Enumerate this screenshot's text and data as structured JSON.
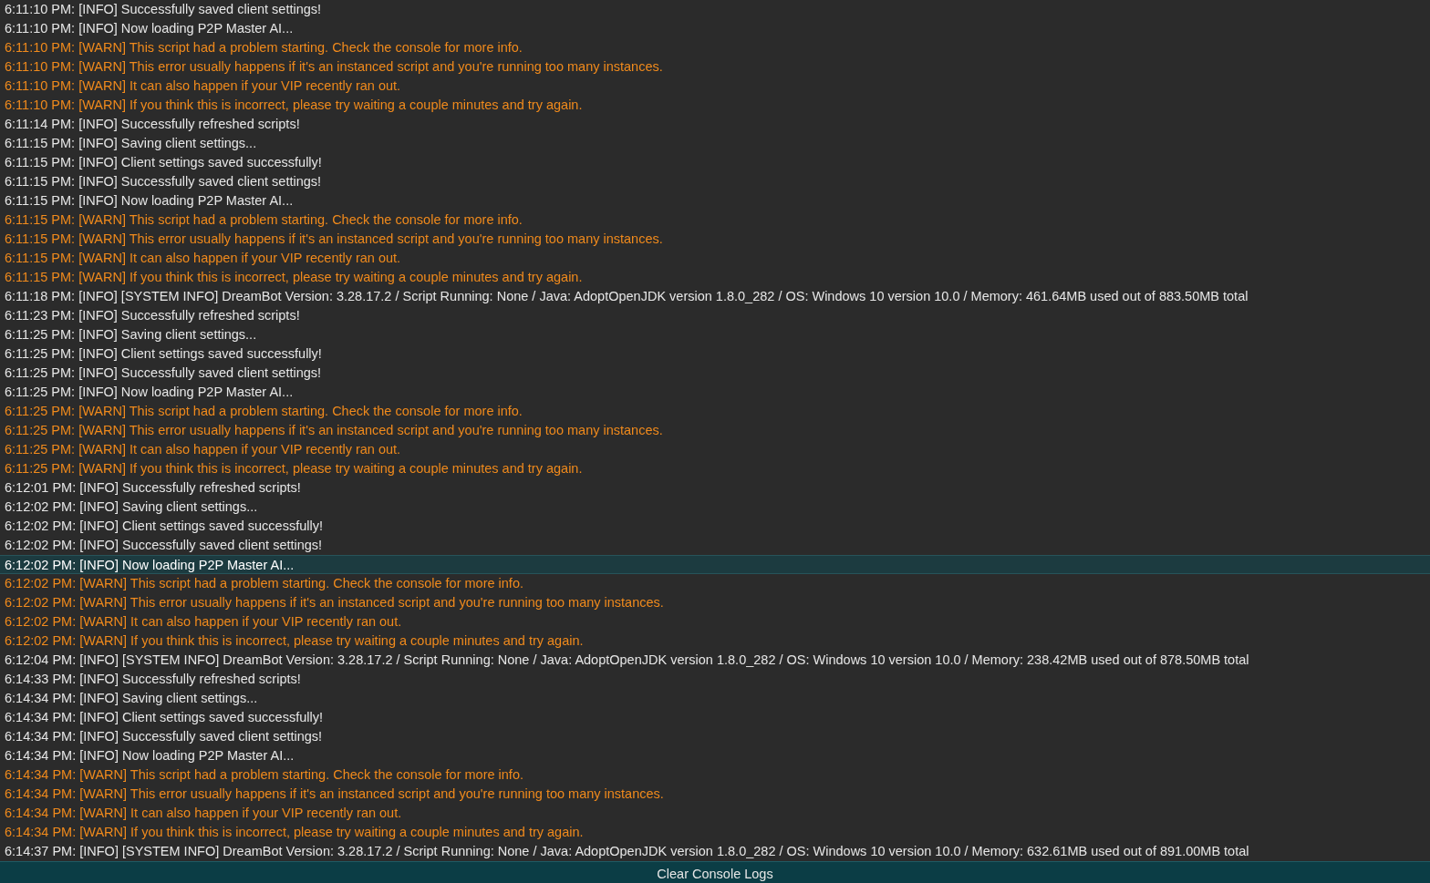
{
  "log_lines": [
    {
      "kind": "info",
      "selected": false,
      "text": "6:11:10 PM: [INFO] Successfully saved client settings!"
    },
    {
      "kind": "info",
      "selected": false,
      "text": "6:11:10 PM: [INFO] Now loading P2P Master AI..."
    },
    {
      "kind": "warn",
      "selected": false,
      "text": "6:11:10 PM: [WARN] This script had a problem starting. Check the console for more info."
    },
    {
      "kind": "warn",
      "selected": false,
      "text": "6:11:10 PM: [WARN] This error usually happens if it's an instanced script and you're running too many instances."
    },
    {
      "kind": "warn",
      "selected": false,
      "text": "6:11:10 PM: [WARN] It can also happen if your VIP recently ran out."
    },
    {
      "kind": "warn",
      "selected": false,
      "text": "6:11:10 PM: [WARN] If you think this is incorrect, please try waiting a couple minutes and try again."
    },
    {
      "kind": "info",
      "selected": false,
      "text": "6:11:14 PM: [INFO] Successfully refreshed scripts!"
    },
    {
      "kind": "info",
      "selected": false,
      "text": "6:11:15 PM: [INFO] Saving client settings..."
    },
    {
      "kind": "info",
      "selected": false,
      "text": "6:11:15 PM: [INFO] Client settings saved successfully!"
    },
    {
      "kind": "info",
      "selected": false,
      "text": "6:11:15 PM: [INFO] Successfully saved client settings!"
    },
    {
      "kind": "info",
      "selected": false,
      "text": "6:11:15 PM: [INFO] Now loading P2P Master AI..."
    },
    {
      "kind": "warn",
      "selected": false,
      "text": "6:11:15 PM: [WARN] This script had a problem starting. Check the console for more info."
    },
    {
      "kind": "warn",
      "selected": false,
      "text": "6:11:15 PM: [WARN] This error usually happens if it's an instanced script and you're running too many instances."
    },
    {
      "kind": "warn",
      "selected": false,
      "text": "6:11:15 PM: [WARN] It can also happen if your VIP recently ran out."
    },
    {
      "kind": "warn",
      "selected": false,
      "text": "6:11:15 PM: [WARN] If you think this is incorrect, please try waiting a couple minutes and try again."
    },
    {
      "kind": "info",
      "selected": false,
      "text": "6:11:18 PM: [INFO] [SYSTEM INFO] DreamBot Version: 3.28.17.2 / Script Running: None / Java: AdoptOpenJDK version 1.8.0_282 / OS: Windows 10 version 10.0 / Memory: 461.64MB used out of 883.50MB total"
    },
    {
      "kind": "info",
      "selected": false,
      "text": "6:11:23 PM: [INFO] Successfully refreshed scripts!"
    },
    {
      "kind": "info",
      "selected": false,
      "text": "6:11:25 PM: [INFO] Saving client settings..."
    },
    {
      "kind": "info",
      "selected": false,
      "text": "6:11:25 PM: [INFO] Client settings saved successfully!"
    },
    {
      "kind": "info",
      "selected": false,
      "text": "6:11:25 PM: [INFO] Successfully saved client settings!"
    },
    {
      "kind": "info",
      "selected": false,
      "text": "6:11:25 PM: [INFO] Now loading P2P Master AI..."
    },
    {
      "kind": "warn",
      "selected": false,
      "text": "6:11:25 PM: [WARN] This script had a problem starting. Check the console for more info."
    },
    {
      "kind": "warn",
      "selected": false,
      "text": "6:11:25 PM: [WARN] This error usually happens if it's an instanced script and you're running too many instances."
    },
    {
      "kind": "warn",
      "selected": false,
      "text": "6:11:25 PM: [WARN] It can also happen if your VIP recently ran out."
    },
    {
      "kind": "warn",
      "selected": false,
      "text": "6:11:25 PM: [WARN] If you think this is incorrect, please try waiting a couple minutes and try again."
    },
    {
      "kind": "info",
      "selected": false,
      "text": "6:12:01 PM: [INFO] Successfully refreshed scripts!"
    },
    {
      "kind": "info",
      "selected": false,
      "text": "6:12:02 PM: [INFO] Saving client settings..."
    },
    {
      "kind": "info",
      "selected": false,
      "text": "6:12:02 PM: [INFO] Client settings saved successfully!"
    },
    {
      "kind": "info",
      "selected": false,
      "text": "6:12:02 PM: [INFO] Successfully saved client settings!"
    },
    {
      "kind": "info",
      "selected": true,
      "text": "6:12:02 PM: [INFO] Now loading P2P Master AI..."
    },
    {
      "kind": "warn",
      "selected": false,
      "text": "6:12:02 PM: [WARN] This script had a problem starting. Check the console for more info."
    },
    {
      "kind": "warn",
      "selected": false,
      "text": "6:12:02 PM: [WARN] This error usually happens if it's an instanced script and you're running too many instances."
    },
    {
      "kind": "warn",
      "selected": false,
      "text": "6:12:02 PM: [WARN] It can also happen if your VIP recently ran out."
    },
    {
      "kind": "warn",
      "selected": false,
      "text": "6:12:02 PM: [WARN] If you think this is incorrect, please try waiting a couple minutes and try again."
    },
    {
      "kind": "info",
      "selected": false,
      "text": "6:12:04 PM: [INFO] [SYSTEM INFO] DreamBot Version: 3.28.17.2 / Script Running: None / Java: AdoptOpenJDK version 1.8.0_282 / OS: Windows 10 version 10.0 / Memory: 238.42MB used out of 878.50MB total"
    },
    {
      "kind": "info",
      "selected": false,
      "text": "6:14:33 PM: [INFO] Successfully refreshed scripts!"
    },
    {
      "kind": "info",
      "selected": false,
      "text": "6:14:34 PM: [INFO] Saving client settings..."
    },
    {
      "kind": "info",
      "selected": false,
      "text": "6:14:34 PM: [INFO] Client settings saved successfully!"
    },
    {
      "kind": "info",
      "selected": false,
      "text": "6:14:34 PM: [INFO] Successfully saved client settings!"
    },
    {
      "kind": "info",
      "selected": false,
      "text": "6:14:34 PM: [INFO] Now loading P2P Master AI..."
    },
    {
      "kind": "warn",
      "selected": false,
      "text": "6:14:34 PM: [WARN] This script had a problem starting. Check the console for more info."
    },
    {
      "kind": "warn",
      "selected": false,
      "text": "6:14:34 PM: [WARN] This error usually happens if it's an instanced script and you're running too many instances."
    },
    {
      "kind": "warn",
      "selected": false,
      "text": "6:14:34 PM: [WARN] It can also happen if your VIP recently ran out."
    },
    {
      "kind": "warn",
      "selected": false,
      "text": "6:14:34 PM: [WARN] If you think this is incorrect, please try waiting a couple minutes and try again."
    },
    {
      "kind": "info",
      "selected": false,
      "text": "6:14:37 PM: [INFO] [SYSTEM INFO] DreamBot Version: 3.28.17.2 / Script Running: None / Java: AdoptOpenJDK version 1.8.0_282 / OS: Windows 10 version 10.0 / Memory: 632.61MB used out of 891.00MB total"
    }
  ],
  "clear_button": {
    "label": "Clear Console Logs"
  }
}
